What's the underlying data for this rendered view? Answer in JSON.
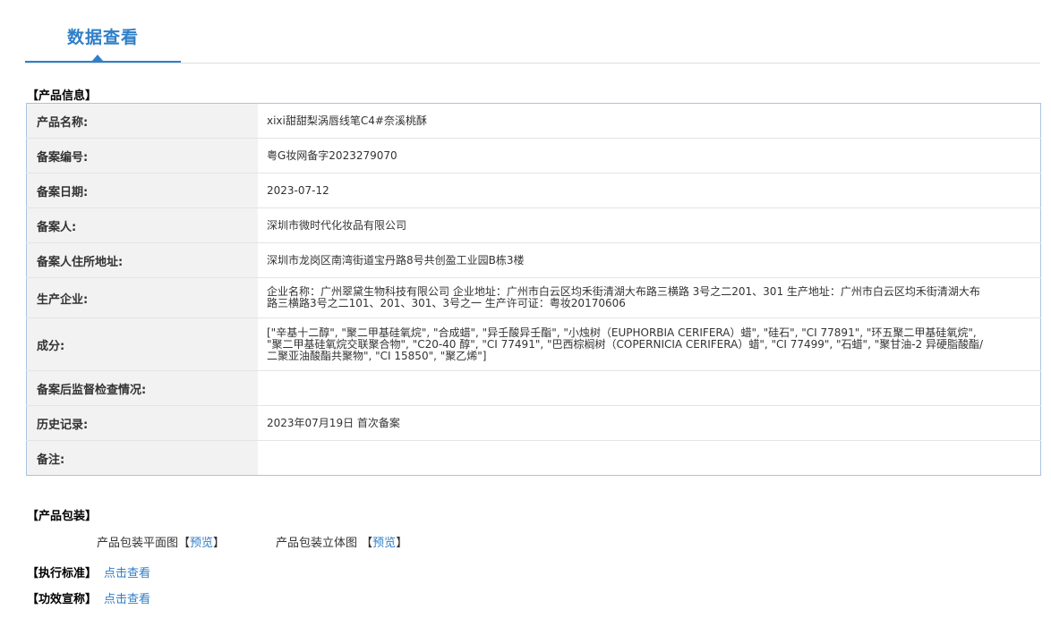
{
  "header": {
    "tab_title": "数据查看"
  },
  "product_info": {
    "heading": "【产品信息】",
    "rows": [
      {
        "label": "产品名称:",
        "value": "xixi甜甜梨涡唇线笔C4#奈溪桃酥"
      },
      {
        "label": "备案编号:",
        "value": "粤G妆网备字2023279070"
      },
      {
        "label": "备案日期:",
        "value": "2023-07-12"
      },
      {
        "label": "备案人:",
        "value": "深圳市微时代化妆品有限公司"
      },
      {
        "label": "备案人住所地址:",
        "value": "深圳市龙岗区南湾街道宝丹路8号共创盈工业园B栋3楼"
      },
      {
        "label": "生产企业:",
        "value": "企业名称：广州翠黛生物科技有限公司 企业地址：广州市白云区均禾街清湖大布路三横路 3号之二201、301 生产地址：广州市白云区均禾街清湖大布路三横路3号之二101、201、301、3号之一 生产许可证：粤妆20170606"
      },
      {
        "label": "成分:",
        "value": "[\"辛基十二醇\", \"聚二甲基硅氧烷\", \"合成蜡\", \"异壬酸异壬酯\", \"小烛树（EUPHORBIA CERIFERA）蜡\", \"硅石\", \"CI 77891\", \"环五聚二甲基硅氧烷\", \"聚二甲基硅氧烷交联聚合物\", \"C20-40 醇\", \"CI 77491\", \"巴西棕榈树（COPERNICIA CERIFERA）蜡\", \"CI 77499\", \"石蜡\", \"聚甘油-2 异硬脂酸酯/二聚亚油酸酯共聚物\", \"CI 15850\", \"聚乙烯\"]"
      },
      {
        "label": "备案后监督检查情况:",
        "value": ""
      },
      {
        "label": "历史记录:",
        "value": "2023年07月19日 首次备案"
      },
      {
        "label": "备注:",
        "value": ""
      }
    ]
  },
  "packaging": {
    "heading": "【产品包装】",
    "flat_label": "产品包装平面图",
    "flat_link": "预览",
    "stereo_label": "产品包装立体图",
    "stereo_link": "预览"
  },
  "standard": {
    "heading": "【执行标准】",
    "link": "点击查看"
  },
  "efficacy": {
    "heading": "【功效宣称】",
    "link": "点击查看"
  }
}
